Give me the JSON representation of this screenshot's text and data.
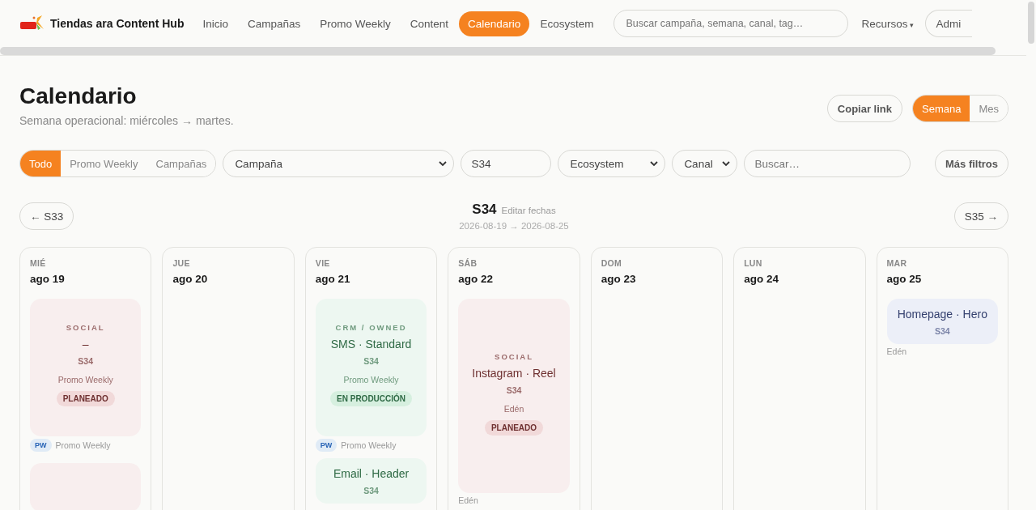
{
  "brand": {
    "name": "Tiendas ara Content Hub"
  },
  "nav": [
    {
      "label": "Inicio",
      "selected": false
    },
    {
      "label": "Campañas",
      "selected": false
    },
    {
      "label": "Promo Weekly",
      "selected": false
    },
    {
      "label": "Content",
      "selected": false
    },
    {
      "label": "Calendario",
      "selected": true
    },
    {
      "label": "Ecosystem",
      "selected": false
    }
  ],
  "search": {
    "placeholder": "Buscar campaña, semana, canal, tag…"
  },
  "resources": {
    "label": "Recursos",
    "caret": "▾"
  },
  "admin": {
    "label": "Admi"
  },
  "page": {
    "title": "Calendario",
    "subtitle": "Semana operacional: miércoles → martes.",
    "copy_link": "Copiar link"
  },
  "view_toggle": [
    {
      "label": "Semana",
      "selected": true
    },
    {
      "label": "Mes",
      "selected": false
    }
  ],
  "scope_toggle": [
    {
      "label": "Todo",
      "selected": true
    },
    {
      "label": "Promo Weekly",
      "selected": false
    },
    {
      "label": "Campañas",
      "selected": false
    }
  ],
  "filters": {
    "campaign": "Campaña",
    "week": "S34",
    "ecosystem": "Ecosystem",
    "channel": "Canal",
    "search_placeholder": "Buscar…",
    "more": "Más filtros"
  },
  "week_nav": {
    "prev": "← S33",
    "current": "S34",
    "edit": "Editar fechas",
    "range": "2026-08-19 → 2026-08-25",
    "next": "S35 →"
  },
  "days": [
    {
      "weekday": "MIÉ",
      "date": "ago 19",
      "cards": [
        {
          "kind": "full",
          "color": "#f8eeee",
          "channel": "SOCIAL",
          "title": "–",
          "week": "S34",
          "source": "Promo Weekly",
          "status": "PLANEADO",
          "footer_tag": "PW",
          "footer": "Promo Weekly"
        },
        {
          "kind": "blank",
          "color": "#f8eeee"
        }
      ]
    },
    {
      "weekday": "JUE",
      "date": "ago 20"
    },
    {
      "weekday": "VIE",
      "date": "ago 21",
      "cards": [
        {
          "kind": "full",
          "color": "#edf7f1",
          "channel": "CRM / OWNED",
          "title": "SMS · Standard",
          "week": "S34",
          "source": "Promo Weekly",
          "status": "EN PRODUCCIÓN",
          "footer_tag": "PW",
          "footer": "Promo Weekly"
        },
        {
          "kind": "compact",
          "color": "#edf7f1",
          "title": "Email · Header",
          "week": "S34"
        }
      ]
    },
    {
      "weekday": "SÁB",
      "date": "ago 22",
      "cards": [
        {
          "kind": "tall",
          "color": "#f8eeee",
          "channel": "SOCIAL",
          "title": "Instagram · Reel",
          "week": "S34",
          "source": "Edén",
          "status": "PLANEADO",
          "footer": "Edén"
        }
      ]
    },
    {
      "weekday": "DOM",
      "date": "ago 23"
    },
    {
      "weekday": "LUN",
      "date": "ago 24"
    },
    {
      "weekday": "MAR",
      "date": "ago 25",
      "cards": [
        {
          "kind": "compact",
          "color": "#eceff8",
          "title": "Homepage · Hero",
          "week": "S34",
          "footer": "Edén"
        }
      ]
    }
  ]
}
